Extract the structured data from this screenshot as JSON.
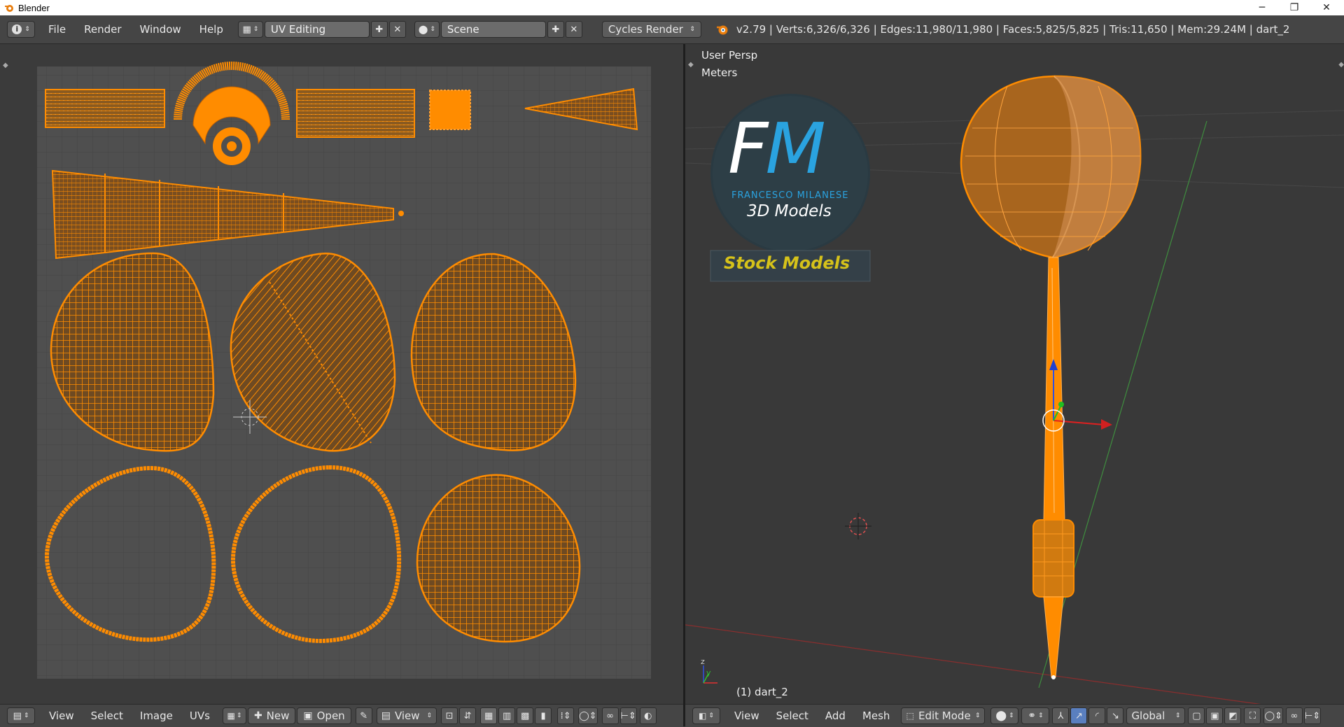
{
  "window": {
    "title": "Blender",
    "minimize": "─",
    "restore": "❐",
    "close": "✕"
  },
  "info_header": {
    "menus": [
      "File",
      "Render",
      "Window",
      "Help"
    ],
    "layout": "UV Editing",
    "scene": "Scene",
    "engine": "Cycles Render",
    "stats": "v2.79 | Verts:6,326/6,326 | Edges:11,980/11,980 | Faces:5,825/5,825 | Tris:11,650 | Mem:29.24M | dart_2"
  },
  "uv_editor": {
    "menus": [
      "View",
      "Select",
      "Image",
      "UVs"
    ],
    "new_label": "New",
    "open_label": "Open",
    "view_label": "View"
  },
  "viewport": {
    "view_name": "User Persp",
    "units": "Meters",
    "object_label": "(1) dart_2",
    "menus": [
      "View",
      "Select",
      "Add",
      "Mesh"
    ],
    "mode": "Edit Mode",
    "orientation": "Global",
    "logo": {
      "initials_f": "F",
      "initials_m": "M",
      "name": "FRANCESCO MILANESE",
      "tagline": "3D Models",
      "banner": "Stock Models"
    }
  },
  "colors": {
    "uv_orange": "#ff8c00",
    "header_bg": "#454545",
    "logo_blue": "#2aa3e0",
    "banner_yellow": "#d6c21a"
  }
}
